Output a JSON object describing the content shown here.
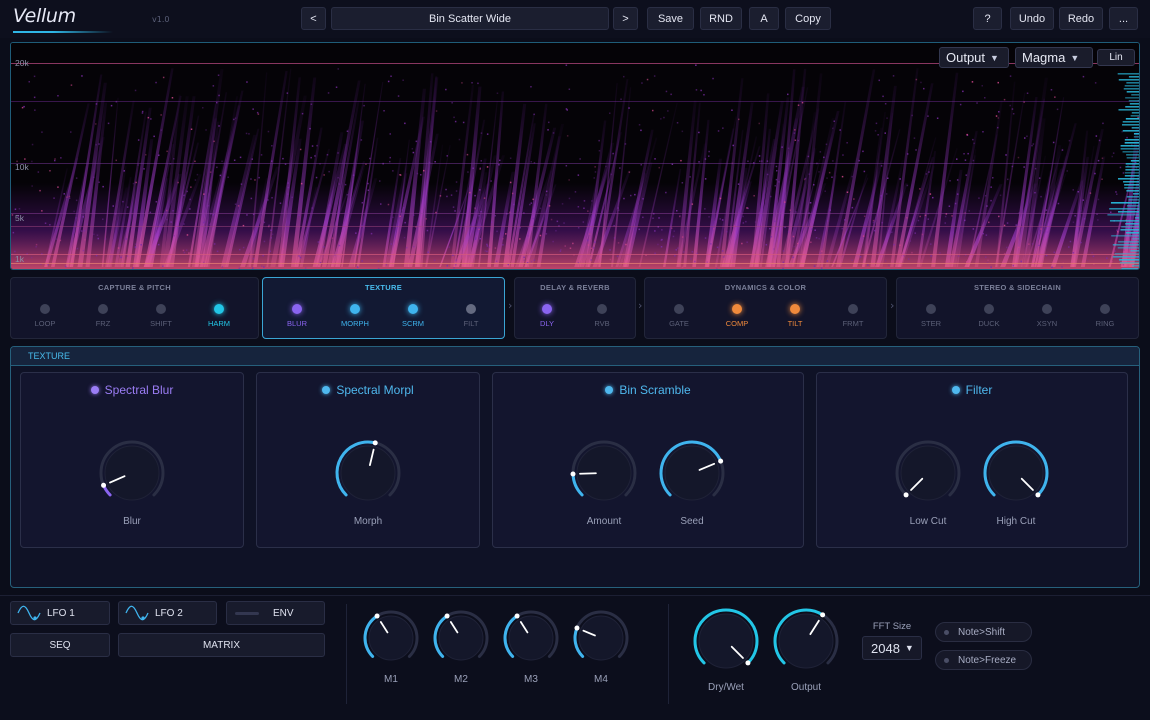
{
  "app": {
    "name": "Vellum",
    "version": "v1.0"
  },
  "toolbar": {
    "prev": "<",
    "next": ">",
    "preset": "Bin Scatter Wide",
    "save": "Save",
    "rnd": "RND",
    "ab": "A",
    "copy": "Copy",
    "help": "?",
    "undo": "Undo",
    "redo": "Redo",
    "more": "..."
  },
  "spectrogram": {
    "freq_labels": [
      "20k",
      "10k",
      "5k",
      "1k"
    ],
    "source": "Output",
    "colormap": "Magma",
    "scale": "Lin"
  },
  "modules": [
    {
      "title": "CAPTURE & PITCH",
      "active": false,
      "items": [
        {
          "label": "LOOP",
          "on": false,
          "color": "#3e4258"
        },
        {
          "label": "FRZ",
          "on": false,
          "color": "#3e4258"
        },
        {
          "label": "SHIFT",
          "on": false,
          "color": "#3e4258"
        },
        {
          "label": "HARM",
          "on": true,
          "color": "#22c6e6"
        }
      ]
    },
    {
      "title": "TEXTURE",
      "active": true,
      "items": [
        {
          "label": "BLUR",
          "on": true,
          "color": "#8a64f0"
        },
        {
          "label": "MORPH",
          "on": true,
          "color": "#3fb4ee"
        },
        {
          "label": "SCRM",
          "on": true,
          "color": "#3fb4ee"
        },
        {
          "label": "FILT",
          "on": false,
          "color": "#646a80"
        }
      ]
    },
    {
      "title": "DELAY & REVERB",
      "active": false,
      "items": [
        {
          "label": "DLY",
          "on": true,
          "color": "#8a64f0"
        },
        {
          "label": "RVB",
          "on": false,
          "color": "#3e4258"
        }
      ]
    },
    {
      "title": "DYNAMICS & COLOR",
      "active": false,
      "items": [
        {
          "label": "GATE",
          "on": false,
          "color": "#3e4258"
        },
        {
          "label": "COMP",
          "on": true,
          "color": "#f08a3c"
        },
        {
          "label": "TILT",
          "on": true,
          "color": "#f08a3c"
        },
        {
          "label": "FRMT",
          "on": false,
          "color": "#3e4258"
        }
      ]
    },
    {
      "title": "STEREO & SIDECHAIN",
      "active": false,
      "items": [
        {
          "label": "STER",
          "on": false,
          "color": "#3e4258"
        },
        {
          "label": "DUCK",
          "on": false,
          "color": "#3e4258"
        },
        {
          "label": "XSYN",
          "on": false,
          "color": "#3e4258"
        },
        {
          "label": "RING",
          "on": false,
          "color": "#3e4258"
        }
      ]
    }
  ],
  "texture": {
    "title": "TEXTURE",
    "cards": [
      {
        "title": "Spectral Blur",
        "color": "#9b7df5",
        "knobs": [
          {
            "label": "Blur",
            "value": 0.08
          }
        ]
      },
      {
        "title": "Spectral Morpl",
        "color": "#4fb8ee",
        "knobs": [
          {
            "label": "Morph",
            "value": 0.55
          }
        ]
      },
      {
        "title": "Bin Scramble",
        "color": "#4fb8ee",
        "knobs": [
          {
            "label": "Amount",
            "value": 0.16
          },
          {
            "label": "Seed",
            "value": 0.75
          }
        ]
      },
      {
        "title": "Filter",
        "color": "#4fb8ee",
        "knobs": [
          {
            "label": "Low Cut",
            "value": 0.0
          },
          {
            "label": "High Cut",
            "value": 1.0
          }
        ]
      }
    ]
  },
  "mod_sources": {
    "lfo1": "LFO 1",
    "lfo2": "LFO 2",
    "env": "ENV",
    "seq": "SEQ",
    "matrix": "MATRIX"
  },
  "macros": [
    {
      "label": "M1",
      "value": 0.38
    },
    {
      "label": "M2",
      "value": 0.38
    },
    {
      "label": "M3",
      "value": 0.38
    },
    {
      "label": "M4",
      "value": 0.25
    }
  ],
  "master": {
    "drywet": {
      "label": "Dry/Wet",
      "value": 1.0
    },
    "output": {
      "label": "Output",
      "value": 0.62
    },
    "fft_label": "FFT Size",
    "fft_value": "2048",
    "note_shift": "Note>Shift",
    "note_freeze": "Note>Freeze"
  },
  "colors": {
    "accent": "#2fb6e6",
    "purple": "#8a64f0",
    "orange": "#f08a3c",
    "bg": "#0b0d1a"
  }
}
